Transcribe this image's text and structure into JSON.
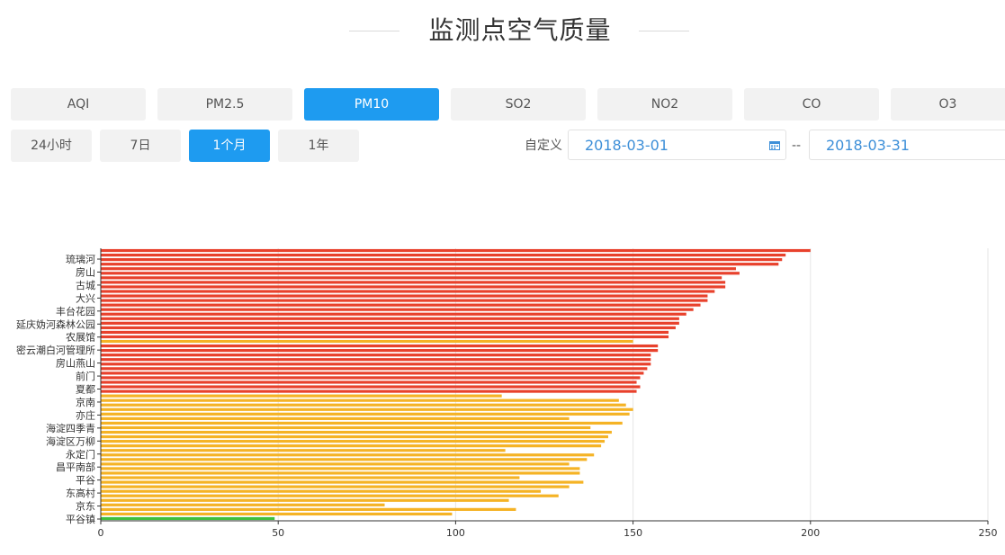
{
  "page": {
    "title": "监测点空气质量"
  },
  "pollutant_tabs": [
    {
      "label": "AQI",
      "active": false
    },
    {
      "label": "PM2.5",
      "active": false
    },
    {
      "label": "PM10",
      "active": true
    },
    {
      "label": "SO2",
      "active": false
    },
    {
      "label": "NO2",
      "active": false
    },
    {
      "label": "CO",
      "active": false
    },
    {
      "label": "O3",
      "active": false
    }
  ],
  "time_tabs": [
    {
      "label": "24小时",
      "active": false
    },
    {
      "label": "7日",
      "active": false
    },
    {
      "label": "1个月",
      "active": true
    },
    {
      "label": "1年",
      "active": false
    }
  ],
  "date_range": {
    "label": "自定义",
    "start": "2018-03-01",
    "separator": "--",
    "end": "2018-03-31"
  },
  "colors": {
    "accent": "#1e9bf0",
    "red_bar": "#e8412c",
    "orange_bar": "#f5b325",
    "green_bar": "#3fbf3f"
  },
  "chart_data": {
    "type": "bar",
    "orientation": "horizontal",
    "xlim": [
      0,
      250
    ],
    "xticks": [
      "0",
      "50",
      "100",
      "150",
      "200",
      "250"
    ],
    "ytick_labels": [
      "琉璃河",
      "房山",
      "古城",
      "大兴",
      "丰台花园",
      "延庆妫河森林公园",
      "农展馆",
      "密云潮白河管理所",
      "房山燕山",
      "前门",
      "夏都",
      "京南",
      "亦庄",
      "海淀四季青",
      "海淀区万柳",
      "永定门",
      "昌平南部",
      "平谷",
      "东高村",
      "京东",
      "平谷镇"
    ],
    "values": [
      200,
      193,
      192,
      191,
      179,
      180,
      175,
      176,
      176,
      173,
      171,
      171,
      169,
      167,
      165,
      163,
      163,
      162,
      160,
      160,
      150,
      157,
      157,
      155,
      155,
      155,
      154,
      153,
      152,
      151,
      152,
      151,
      113,
      146,
      148,
      150,
      149,
      132,
      147,
      138,
      144,
      143,
      142,
      141,
      114,
      139,
      137,
      132,
      135,
      135,
      118,
      136,
      132,
      124,
      129,
      115,
      80,
      117,
      99,
      49
    ],
    "grid": true
  }
}
